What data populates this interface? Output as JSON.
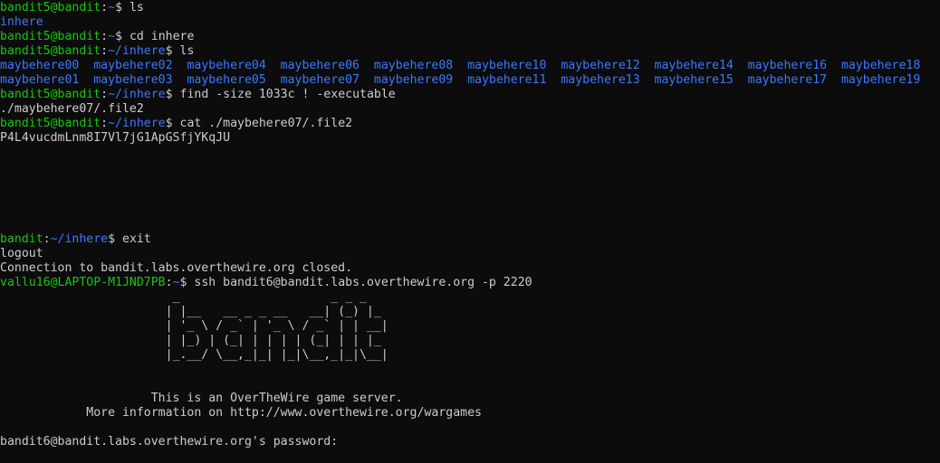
{
  "colors": {
    "background": "#0c0c0c",
    "user_host": "#16c60c",
    "path_dir": "#3b78ff",
    "text": "#cccccc"
  },
  "lines": {
    "l1": {
      "user": "bandit5@bandit",
      "sep": ":",
      "path": "~",
      "cmd": "$ ls"
    },
    "l2": {
      "dir": "inhere"
    },
    "l3": {
      "user": "bandit5@bandit",
      "sep": ":",
      "path": "~",
      "cmd": "$ cd inhere"
    },
    "l4": {
      "user": "bandit5@bandit",
      "sep": ":",
      "path": "~/inhere",
      "cmd": "$ ls"
    },
    "files_row1": [
      "maybehere00",
      "maybehere02",
      "maybehere04",
      "maybehere06",
      "maybehere08",
      "maybehere10",
      "maybehere12",
      "maybehere14",
      "maybehere16",
      "maybehere18"
    ],
    "files_row2": [
      "maybehere01",
      "maybehere03",
      "maybehere05",
      "maybehere07",
      "maybehere09",
      "maybehere11",
      "maybehere13",
      "maybehere15",
      "maybehere17",
      "maybehere19"
    ],
    "l7": {
      "user": "bandit5@bandit",
      "sep": ":",
      "path": "~/inhere",
      "cmd": "$ find -size 1033c ! -executable"
    },
    "l8": {
      "text": "./maybehere07/.file2"
    },
    "l9": {
      "user": "bandit5@bandit",
      "sep": ":",
      "path": "~/inhere",
      "cmd": "$ cat ./maybehere07/.file2"
    },
    "l10": {
      "text": "P4L4vucdmLnm8I7Vl7jG1ApGSfjYKqJU"
    },
    "l11": {
      "user": "bandit",
      "sep": ":",
      "path": "~/inhere",
      "cmd": "$ exit"
    },
    "l12": {
      "text": "logout"
    },
    "l13": {
      "text": "Connection to bandit.labs.overthewire.org closed."
    },
    "l14": {
      "user": "vallu16@LAPTOP-M1JND7PB",
      "sep": ":",
      "path": "~",
      "cmd": "$ ssh bandit6@bandit.labs.overthewire.org -p 2220"
    },
    "banner": [
      "                        _                     _ _ _   ",
      "                       | |__   __ _ _ __   __| (_) |_ ",
      "                       | '_ \\ / _` | '_ \\ / _` | | __|",
      "                       | |_) | (_| | | | | (_| | | |_ ",
      "                       |_.__/ \\__,_|_| |_|\\__,_|_|\\__|"
    ],
    "info1": "                     This is an OverTheWire game server.",
    "info2": "            More information on http://www.overthewire.org/wargames",
    "prompt": "bandit6@bandit.labs.overthewire.org's password:"
  }
}
